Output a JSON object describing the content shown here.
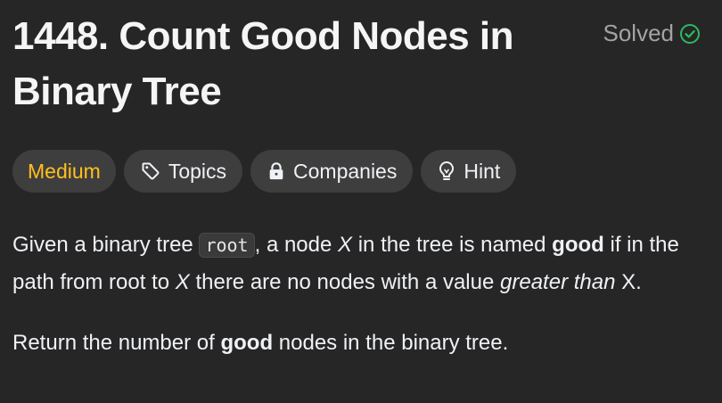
{
  "problem": {
    "title": "1448. Count Good Nodes in Binary Tree",
    "status": "Solved"
  },
  "tags": {
    "difficulty": "Medium",
    "topics": "Topics",
    "companies": "Companies",
    "hint": "Hint"
  },
  "colors": {
    "difficulty_medium": "#ffc01e",
    "solved_check": "#2cbb5d",
    "background": "#262626",
    "pill_background": "#3e3e3e"
  },
  "icons": {
    "solved": "check-circle-icon",
    "topics": "tag-icon",
    "companies": "lock-icon",
    "hint": "lightbulb-icon"
  },
  "description": {
    "p1_a": "Given a binary tree ",
    "p1_code": "root",
    "p1_b": ", a node ",
    "p1_x1": "X",
    "p1_c": " in the tree is named ",
    "p1_good": "good",
    "p1_d": " if in the path from root to ",
    "p1_x2": "X",
    "p1_e": " there are no nodes with a value ",
    "p1_greater": "greater than",
    "p1_f": " X.",
    "p2_a": "Return the number of ",
    "p2_good": "good",
    "p2_b": " nodes in the binary tree."
  }
}
